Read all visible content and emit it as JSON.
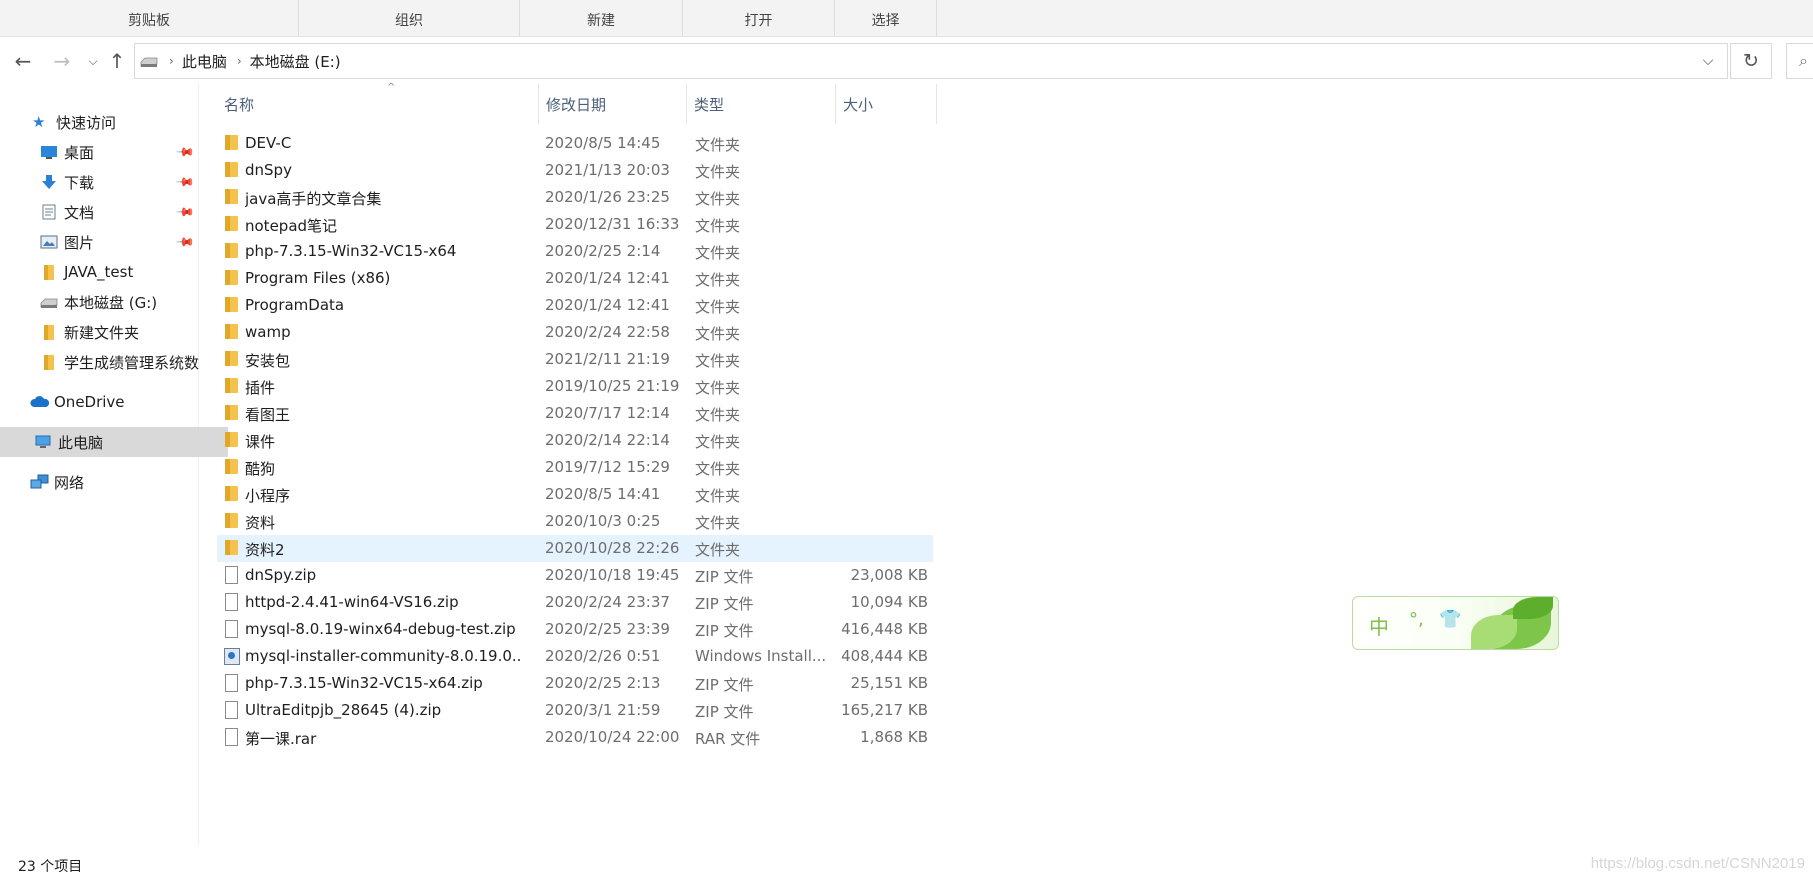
{
  "ribbon": {
    "groups": [
      "剪贴板",
      "组织",
      "新建",
      "打开",
      "选择"
    ]
  },
  "address": {
    "crumbs": [
      "此电脑",
      "本地磁盘 (E:)"
    ]
  },
  "sidebar": {
    "quick_access": "快速访问",
    "items": [
      {
        "label": "桌面",
        "icon": "desktop-icon",
        "pinned": true
      },
      {
        "label": "下载",
        "icon": "download-icon",
        "pinned": true
      },
      {
        "label": "文档",
        "icon": "documents-icon",
        "pinned": true
      },
      {
        "label": "图片",
        "icon": "pictures-icon",
        "pinned": true
      },
      {
        "label": "JAVA_test",
        "icon": "folder-icon",
        "pinned": false
      },
      {
        "label": "本地磁盘 (G:)",
        "icon": "drive-icon",
        "pinned": false
      },
      {
        "label": "新建文件夹",
        "icon": "folder-icon",
        "pinned": false
      },
      {
        "label": "学生成绩管理系统数",
        "icon": "folder-icon",
        "pinned": false
      }
    ],
    "onedrive": "OneDrive",
    "this_pc": "此电脑",
    "network": "网络"
  },
  "columns": {
    "name": "名称",
    "date": "修改日期",
    "type": "类型",
    "size": "大小"
  },
  "files": [
    {
      "name": "DEV-C",
      "date": "2020/8/5 14:45",
      "type": "文件夹",
      "size": "",
      "icon": "folder-icon"
    },
    {
      "name": "dnSpy",
      "date": "2021/1/13 20:03",
      "type": "文件夹",
      "size": "",
      "icon": "folder-icon"
    },
    {
      "name": "java高手的文章合集",
      "date": "2020/1/26 23:25",
      "type": "文件夹",
      "size": "",
      "icon": "folder-icon"
    },
    {
      "name": "notepad笔记",
      "date": "2020/12/31 16:33",
      "type": "文件夹",
      "size": "",
      "icon": "folder-icon"
    },
    {
      "name": "php-7.3.15-Win32-VC15-x64",
      "date": "2020/2/25 2:14",
      "type": "文件夹",
      "size": "",
      "icon": "folder-icon"
    },
    {
      "name": "Program Files (x86)",
      "date": "2020/1/24 12:41",
      "type": "文件夹",
      "size": "",
      "icon": "folder-icon"
    },
    {
      "name": "ProgramData",
      "date": "2020/1/24 12:41",
      "type": "文件夹",
      "size": "",
      "icon": "folder-icon"
    },
    {
      "name": "wamp",
      "date": "2020/2/24 22:58",
      "type": "文件夹",
      "size": "",
      "icon": "folder-icon"
    },
    {
      "name": "安装包",
      "date": "2021/2/11 21:19",
      "type": "文件夹",
      "size": "",
      "icon": "folder-icon"
    },
    {
      "name": "插件",
      "date": "2019/10/25 21:19",
      "type": "文件夹",
      "size": "",
      "icon": "folder-icon"
    },
    {
      "name": "看图王",
      "date": "2020/7/17 12:14",
      "type": "文件夹",
      "size": "",
      "icon": "folder-icon"
    },
    {
      "name": "课件",
      "date": "2020/2/14 22:14",
      "type": "文件夹",
      "size": "",
      "icon": "folder-icon"
    },
    {
      "name": "酷狗",
      "date": "2019/7/12 15:29",
      "type": "文件夹",
      "size": "",
      "icon": "folder-icon"
    },
    {
      "name": "小程序",
      "date": "2020/8/5 14:41",
      "type": "文件夹",
      "size": "",
      "icon": "folder-icon"
    },
    {
      "name": "资料",
      "date": "2020/10/3 0:25",
      "type": "文件夹",
      "size": "",
      "icon": "folder-icon"
    },
    {
      "name": "资料2",
      "date": "2020/10/28 22:26",
      "type": "文件夹",
      "size": "",
      "icon": "folder-icon",
      "selected": true
    },
    {
      "name": "dnSpy.zip",
      "date": "2020/10/18 19:45",
      "type": "ZIP 文件",
      "size": "23,008 KB",
      "icon": "file-icon"
    },
    {
      "name": "httpd-2.4.41-win64-VS16.zip",
      "date": "2020/2/24 23:37",
      "type": "ZIP 文件",
      "size": "10,094 KB",
      "icon": "file-icon"
    },
    {
      "name": "mysql-8.0.19-winx64-debug-test.zip",
      "date": "2020/2/25 23:39",
      "type": "ZIP 文件",
      "size": "416,448 KB",
      "icon": "file-icon"
    },
    {
      "name": "mysql-installer-community-8.0.19.0....",
      "date": "2020/2/26 0:51",
      "type": "Windows Install...",
      "size": "408,444 KB",
      "icon": "installer-icon"
    },
    {
      "name": "php-7.3.15-Win32-VC15-x64.zip",
      "date": "2020/2/25 2:13",
      "type": "ZIP 文件",
      "size": "25,151 KB",
      "icon": "file-icon"
    },
    {
      "name": "UltraEditpjb_28645 (4).zip",
      "date": "2020/3/1 21:59",
      "type": "ZIP 文件",
      "size": "165,217 KB",
      "icon": "file-icon"
    },
    {
      "name": "第一课.rar",
      "date": "2020/10/24 22:00",
      "type": "RAR 文件",
      "size": "1,868 KB",
      "icon": "file-icon"
    }
  ],
  "status": {
    "count_text": "23 个项目"
  },
  "ime": {
    "mode": "中",
    "punct": "°,",
    "skin": "👕"
  },
  "watermark": "https://blog.csdn.net/CSNN2019"
}
